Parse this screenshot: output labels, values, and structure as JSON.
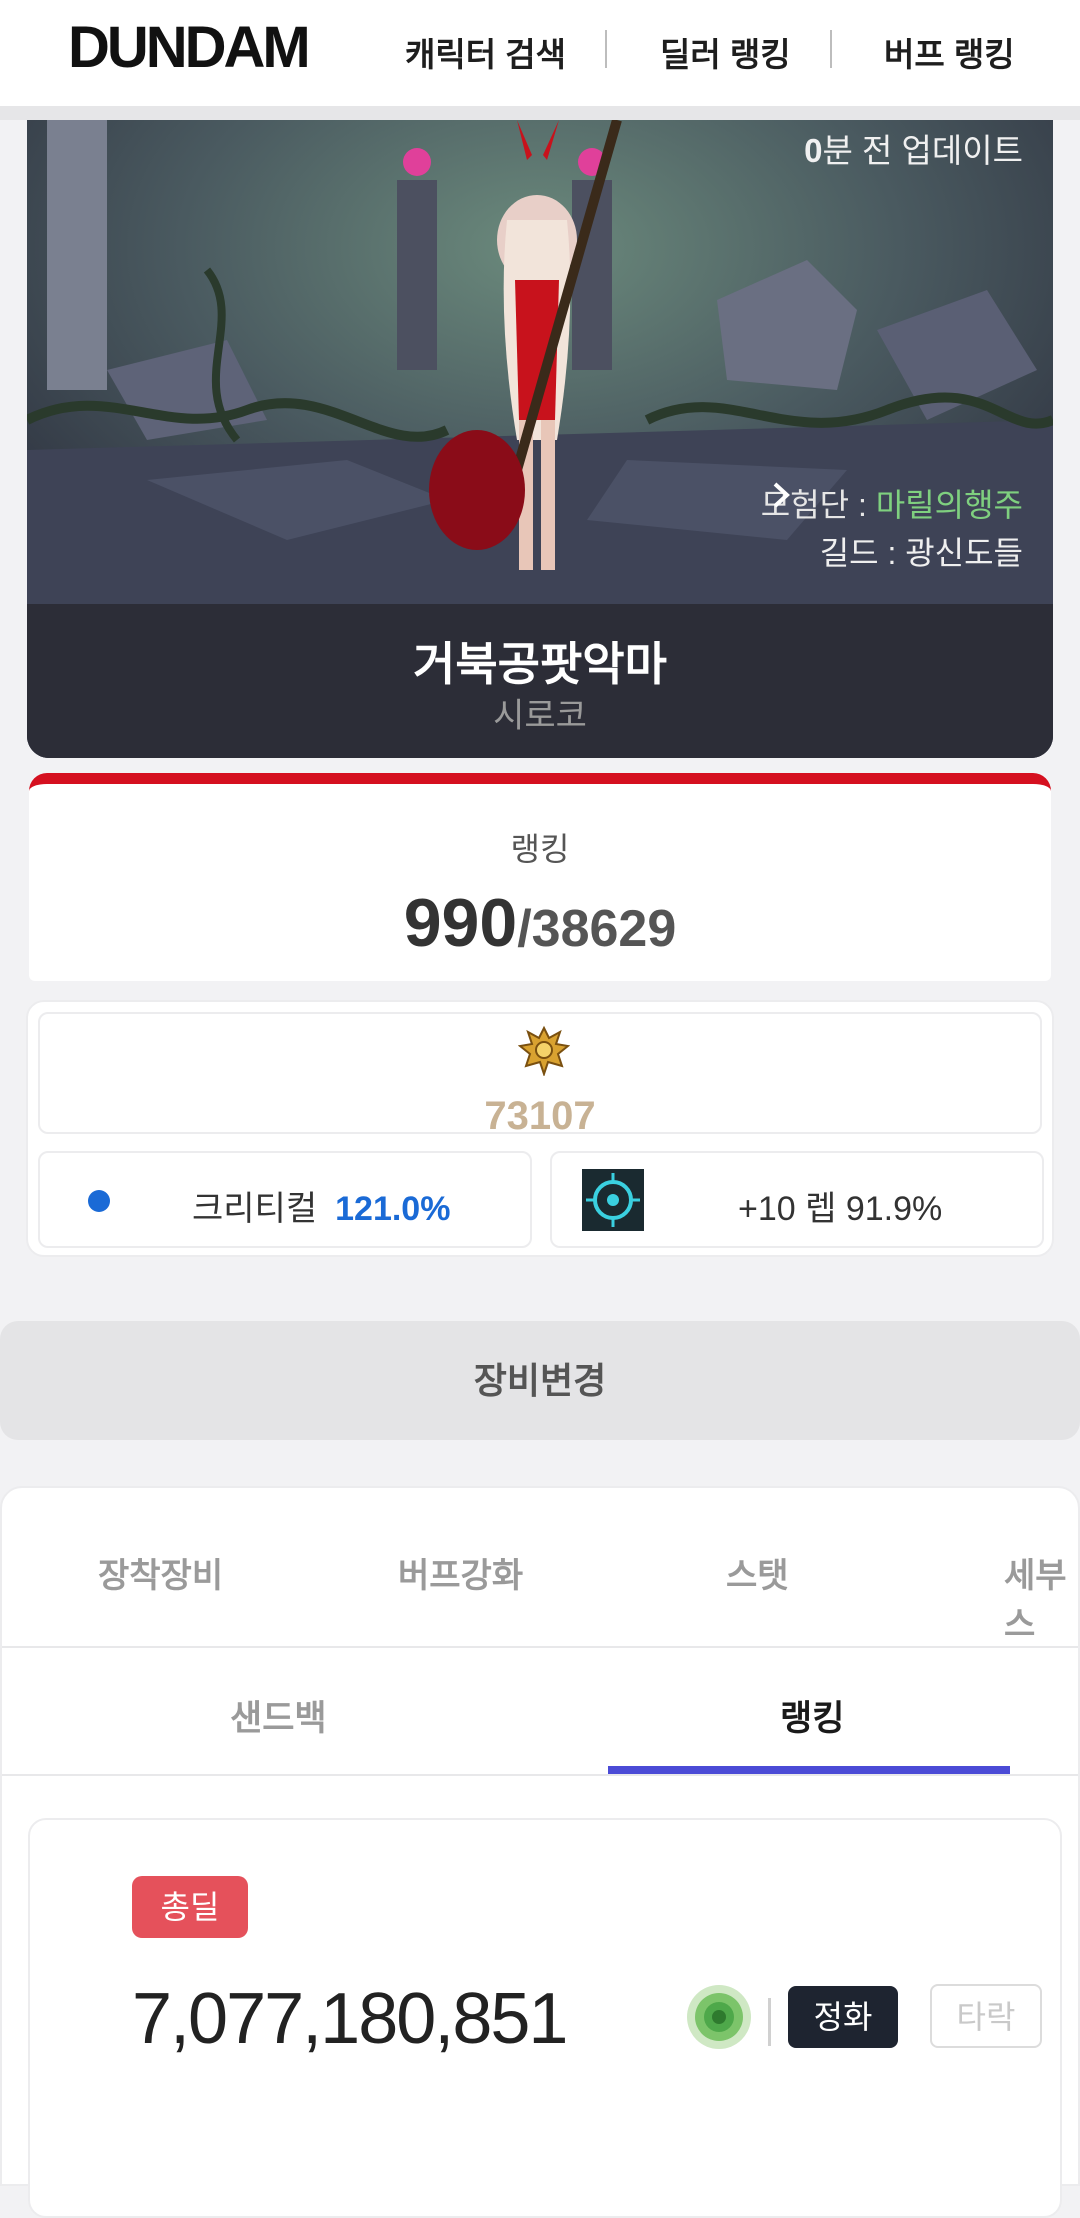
{
  "header": {
    "logo": "DUNDAM",
    "nav": [
      "캐릭터 검색",
      "딜러 랭킹",
      "버프 랭킹"
    ]
  },
  "hero": {
    "update_num": "0",
    "update_suffix": "분 전 업데이트",
    "adventure_label": "모험단 : ",
    "adventure_name": "마릴의행주",
    "guild": "길드 : 광신도들",
    "character_name": "거북공팟악마",
    "server": "시로코"
  },
  "ranking": {
    "label": "랭킹",
    "rank": "990",
    "total": "/38629"
  },
  "stats": {
    "score": "73107",
    "crit_label": "크리티컬",
    "crit_value": "121.0%",
    "enhance": "+10 렙 91.9%"
  },
  "change_equipment": "장비변경",
  "tabs": [
    "장착장비",
    "버프강화",
    "스탯",
    "세부스"
  ],
  "subtabs": [
    "샌드백",
    "랭킹"
  ],
  "damage": {
    "badge": "총딜",
    "value": "7,077,180,851",
    "btn_pure": "정화",
    "btn_fall": "타락"
  },
  "colors": {
    "accent_red": "#d5101f",
    "crit_blue": "#1a6ad6",
    "tab_underline": "#4b4bd6",
    "badge_red": "#e5515b",
    "score_gold": "#c8b294",
    "adventure_green": "#7fd07f"
  },
  "icons": {
    "score": "gold-crest-icon",
    "enhance": "cyan-rune-icon",
    "rose": "green-rose-icon",
    "chevron": "chevron-right-icon"
  }
}
